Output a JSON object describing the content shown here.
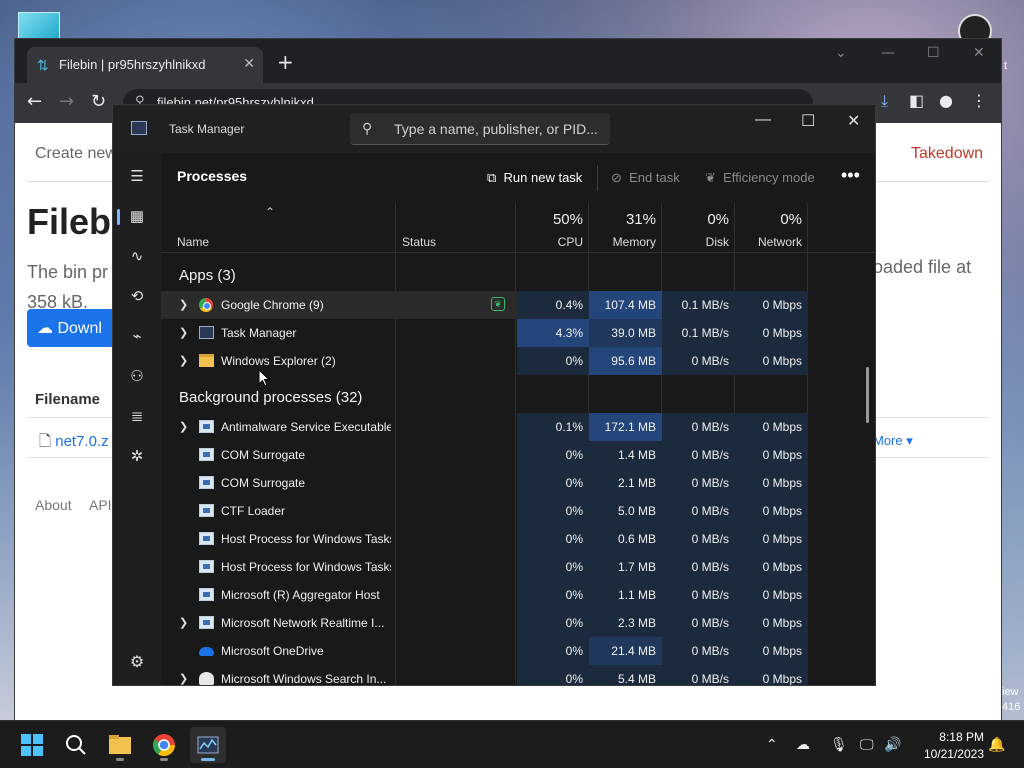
{
  "browser": {
    "tab_title": "Filebin | pr95hrszyhlnikxd",
    "url": "filebin.net/pr95hrszyhlnikxd",
    "new_tab_glyph": "+",
    "close_glyph": "✕"
  },
  "webpage": {
    "create_link": "Create new",
    "takedown_link": "Takedown",
    "heading": "Filebi",
    "text_left": "The bin pr",
    "text_left_2": "358 kB.",
    "text_right": "oaded file at",
    "download_button": "Downl",
    "filename_header": "Filename",
    "file_link": "net7.0.z",
    "more_link": "More ▾",
    "footer_about": "About",
    "footer_api": "API"
  },
  "desktop": {
    "edge_t": "t",
    "edge_iew": "iew",
    "edge_416": "416"
  },
  "taskmanager": {
    "title": "Task Manager",
    "search_placeholder": "Type a name, publisher, or PID...",
    "page_heading": "Processes",
    "run_new_task": "Run new task",
    "end_task": "End task",
    "efficiency_mode": "Efficiency mode",
    "columns": {
      "name": "Name",
      "status": "Status",
      "cpu_pct": "50%",
      "cpu": "CPU",
      "memory_pct": "31%",
      "memory": "Memory",
      "disk_pct": "0%",
      "disk": "Disk",
      "network_pct": "0%",
      "network": "Network"
    },
    "groups": [
      {
        "label": "Apps (3)"
      },
      {
        "label": "Background processes (32)"
      }
    ],
    "rows": [
      {
        "name": "Google Chrome (9)",
        "icon": "chrome-icon",
        "expandable": true,
        "efficiency": true,
        "cpu": "0.4%",
        "memory": "107.4 MB",
        "disk": "0.1 MB/s",
        "network": "0 Mbps"
      },
      {
        "name": "Task Manager",
        "icon": "task-manager-icon",
        "expandable": true,
        "cpu": "4.3%",
        "memory": "39.0 MB",
        "disk": "0.1 MB/s",
        "network": "0 Mbps"
      },
      {
        "name": "Windows Explorer (2)",
        "icon": "folder-icon",
        "expandable": true,
        "cpu": "0%",
        "memory": "95.6 MB",
        "disk": "0 MB/s",
        "network": "0 Mbps"
      },
      {
        "name": "Antimalware Service Executable",
        "icon": "service-icon",
        "expandable": true,
        "cpu": "0.1%",
        "memory": "172.1 MB",
        "disk": "0 MB/s",
        "network": "0 Mbps"
      },
      {
        "name": "COM Surrogate",
        "icon": "service-icon",
        "expandable": false,
        "cpu": "0%",
        "memory": "1.4 MB",
        "disk": "0 MB/s",
        "network": "0 Mbps"
      },
      {
        "name": "COM Surrogate",
        "icon": "service-icon",
        "expandable": false,
        "cpu": "0%",
        "memory": "2.1 MB",
        "disk": "0 MB/s",
        "network": "0 Mbps"
      },
      {
        "name": "CTF Loader",
        "icon": "service-icon",
        "expandable": false,
        "cpu": "0%",
        "memory": "5.0 MB",
        "disk": "0 MB/s",
        "network": "0 Mbps"
      },
      {
        "name": "Host Process for Windows Tasks",
        "icon": "service-icon",
        "expandable": false,
        "cpu": "0%",
        "memory": "0.6 MB",
        "disk": "0 MB/s",
        "network": "0 Mbps"
      },
      {
        "name": "Host Process for Windows Tasks",
        "icon": "service-icon",
        "expandable": false,
        "cpu": "0%",
        "memory": "1.7 MB",
        "disk": "0 MB/s",
        "network": "0 Mbps"
      },
      {
        "name": "Microsoft (R) Aggregator Host",
        "icon": "service-icon",
        "expandable": false,
        "cpu": "0%",
        "memory": "1.1 MB",
        "disk": "0 MB/s",
        "network": "0 Mbps"
      },
      {
        "name": "Microsoft Network Realtime I...",
        "icon": "service-icon",
        "expandable": true,
        "cpu": "0%",
        "memory": "2.3 MB",
        "disk": "0 MB/s",
        "network": "0 Mbps"
      },
      {
        "name": "Microsoft OneDrive",
        "icon": "onedrive-icon",
        "expandable": false,
        "cpu": "0%",
        "memory": "21.4 MB",
        "disk": "0 MB/s",
        "network": "0 Mbps"
      },
      {
        "name": "Microsoft Windows Search In...",
        "icon": "search-indexer-icon",
        "expandable": true,
        "cpu": "0%",
        "memory": "5.4 MB",
        "disk": "0 MB/s",
        "network": "0 Mbps"
      }
    ]
  },
  "taskbar": {
    "time": "8:18 PM",
    "date": "10/21/2023"
  },
  "colors": {
    "accent": "#76b9ed",
    "heat_low": "#1c2a3d",
    "heat_mid": "#20385c",
    "heat_high": "#24457a",
    "takedown": "#c0392b",
    "link": "#1a73e8"
  }
}
